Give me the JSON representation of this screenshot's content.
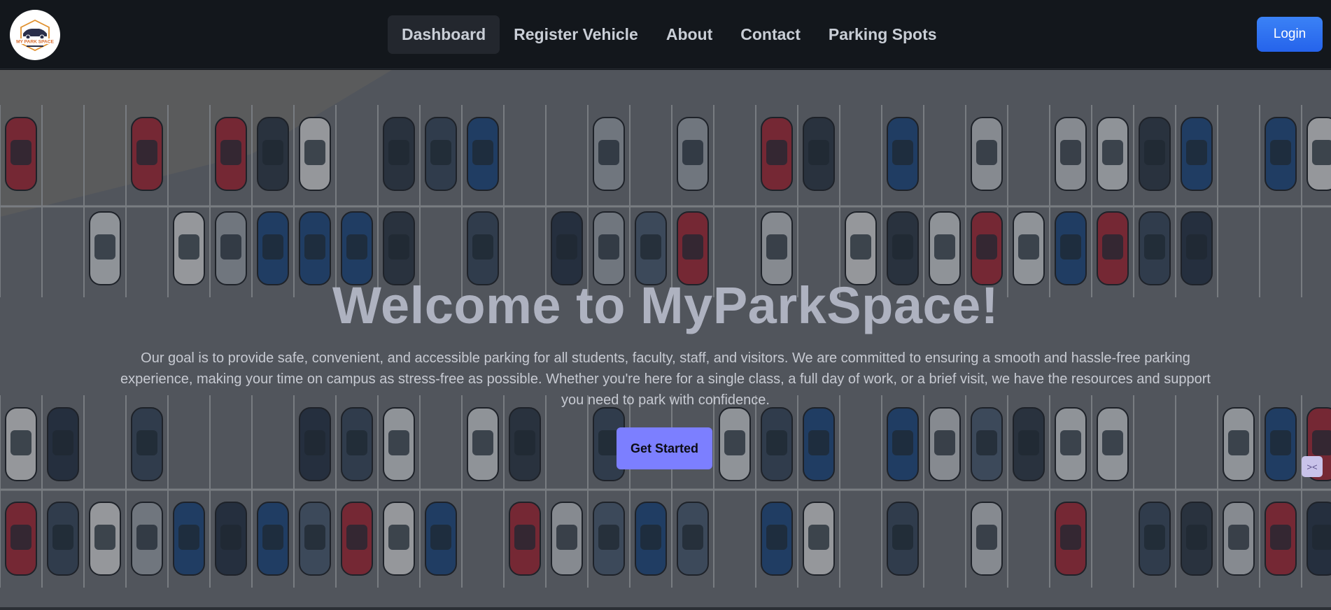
{
  "nav": {
    "logo_text": "MY PARK SPACE",
    "items": [
      {
        "label": "Dashboard",
        "active": true
      },
      {
        "label": "Register Vehicle",
        "active": false
      },
      {
        "label": "About",
        "active": false
      },
      {
        "label": "Contact",
        "active": false
      },
      {
        "label": "Parking Spots",
        "active": false
      }
    ],
    "login_label": "Login"
  },
  "hero": {
    "title": "Welcome to MyParkSpace!",
    "description": "Our goal is to provide safe, convenient, and accessible parking for all students, faculty, staff, and visitors. We are committed to ensuring a smooth and hassle-free parking experience, making your time on campus as stress-free as possible. Whether you're here for a single class, a full day of work, or a brief visit, we have the resources and support you need to park with confidence.",
    "cta_label": "Get Started",
    "background_icon": "parking-lot-aerial-image"
  },
  "colors": {
    "nav_bg": "#13171c",
    "login_bg": "#2563eb",
    "cta_bg": "#7c7fff",
    "title_color": "#aeb2c0"
  }
}
